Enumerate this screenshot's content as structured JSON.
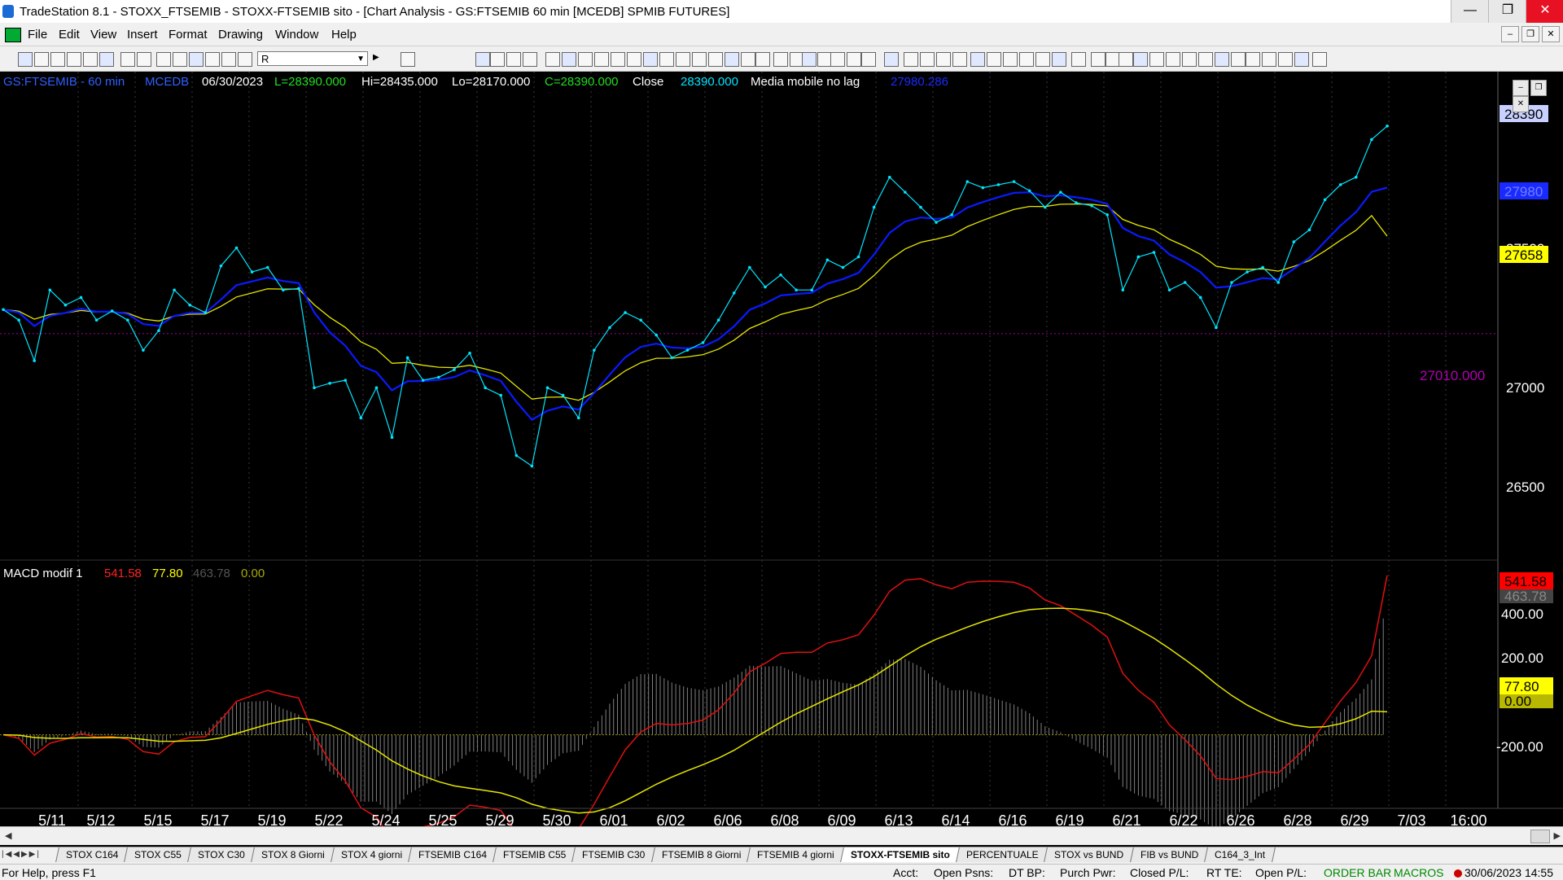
{
  "window": {
    "title": "TradeStation 8.1 - STOXX_FTSEMIB - STOXX-FTSEMIB sito - [Chart Analysis - GS:FTSEMIB  60 min  [MCEDB] SPMIB FUTURES]",
    "minimize": "—",
    "maximize": "❐",
    "close": "✕"
  },
  "menu": [
    "File",
    "Edit",
    "View",
    "Insert",
    "Format",
    "Drawing",
    "Window",
    "Help"
  ],
  "toolbar": {
    "symbol_value": "R"
  },
  "price_header": {
    "symbol": "GS:FTSEMIB - 60 min",
    "exchange": "MCEDB",
    "date": "06/30/2023",
    "last": "L=28390.000",
    "high": "Hi=28435.000",
    "low": "Lo=28170.000",
    "close_eq": "C=28390.000",
    "close_label": "Close",
    "close_value": "28390.000",
    "ma_label": "Media mobile no lag",
    "ma_value": "27980.286"
  },
  "price_axis": {
    "ticks": [
      "27500",
      "27000",
      "26500"
    ],
    "last_tag": "28390",
    "ma_tag": "27980",
    "yellow_tag": "27658",
    "hline_label": "27010.000"
  },
  "macd_header": {
    "name": "MACD modif 1",
    "v1": "541.58",
    "v2": "77.80",
    "v3": "463.78",
    "v4": "0.00"
  },
  "macd_axis": {
    "ticks": [
      "400.00",
      "200.00",
      "-200.00"
    ],
    "tag_red": "541.58",
    "tag_gray": "463.78",
    "tag_yellow": "77.80",
    "tag_zero": "0.00"
  },
  "date_axis": [
    "5/11",
    "5/12",
    "5/15",
    "5/17",
    "5/19",
    "5/22",
    "5/24",
    "5/25",
    "5/29",
    "5/30",
    "6/01",
    "6/02",
    "6/06",
    "6/08",
    "6/09",
    "6/13",
    "6/14",
    "6/16",
    "6/19",
    "6/21",
    "6/22",
    "6/26",
    "6/28",
    "6/29",
    "7/03",
    "16:00"
  ],
  "tabs": [
    "STOX C164",
    "STOX C55",
    "STOX  C30",
    "STOX  8 Giorni",
    "STOX 4 giorni",
    "FTSEMIB C164",
    "FTSEMIB C55",
    "FTSEMIB C30",
    "FTSEMIB  8 Giorni",
    "FTSEMIB  4 giorni",
    "STOXX-FTSEMIB sito",
    "PERCENTUALE",
    "STOX vs BUND",
    "FIB vs BUND",
    "C164_3_Int"
  ],
  "active_tab": "STOXX-FTSEMIB sito",
  "status": {
    "help": "For Help, press F1",
    "acct": "Acct:",
    "open_psns": "Open Psns:",
    "dt_bp": "DT BP:",
    "purch_pwr": "Purch Pwr:",
    "closed_pl": "Closed P/L:",
    "rt_te": "RT TE:",
    "open_pl": "Open P/L:",
    "order_bar": "ORDER BAR",
    "macros": "MACROS",
    "datetime": "30/06/2023 14:55"
  },
  "colors": {
    "price_line": "#00e5ff",
    "blue_ma": "#0a1aff",
    "yellow_ma": "#e6e600",
    "macd_red": "#e01010",
    "macd_yellow": "#e6e600",
    "histogram": "#808080",
    "hline": "#a000a0"
  },
  "chart_data": {
    "type": "line",
    "series": [
      {
        "name": "Close",
        "x": [
          "5/10",
          "5/11",
          "5/11",
          "5/11",
          "5/12",
          "5/12",
          "5/12",
          "5/15",
          "5/15",
          "5/16",
          "5/16",
          "5/17",
          "5/17",
          "5/18",
          "5/18",
          "5/19",
          "5/19",
          "5/19",
          "5/22",
          "5/22",
          "5/23",
          "5/23",
          "5/24",
          "5/24",
          "5/24",
          "5/25",
          "5/25",
          "5/25",
          "5/26",
          "5/26",
          "5/29",
          "5/29",
          "5/29",
          "5/30",
          "5/30",
          "5/30",
          "5/31",
          "5/31",
          "6/01",
          "6/01",
          "6/01",
          "6/02",
          "6/02",
          "6/05",
          "6/05",
          "6/06",
          "6/06",
          "6/07",
          "6/07",
          "6/08",
          "6/08",
          "6/08",
          "6/09",
          "6/09",
          "6/12",
          "6/12",
          "6/13",
          "6/13",
          "6/13",
          "6/14",
          "6/14",
          "6/14",
          "6/15",
          "6/15",
          "6/16",
          "6/16",
          "6/16",
          "6/19",
          "6/19",
          "6/20",
          "6/20",
          "6/21",
          "6/21",
          "6/21",
          "6/22",
          "6/22",
          "6/22",
          "6/23",
          "6/23",
          "6/26",
          "6/26",
          "6/26",
          "6/27",
          "6/27",
          "6/28",
          "6/28",
          "6/29",
          "6/29",
          "6/29",
          "6/30"
        ],
        "y": [
          27170,
          27100,
          26830,
          27300,
          27200,
          27250,
          27100,
          27160,
          27100,
          26900,
          27030,
          27300,
          27200,
          27150,
          27460,
          27580,
          27420,
          27450,
          27300,
          27310,
          26650,
          26680,
          26700,
          26450,
          26650,
          26320,
          26850,
          26700,
          26720,
          26770,
          26880,
          26650,
          26600,
          26200,
          26130,
          26650,
          26600,
          26450,
          26900,
          27050,
          27150,
          27100,
          27000,
          26850,
          26900,
          26950,
          27100,
          27280,
          27450,
          27320,
          27400,
          27300,
          27300,
          27500,
          27450,
          27520,
          27850,
          28050,
          27950,
          27850,
          27750,
          27800,
          28020,
          27980,
          28000,
          28020,
          27960,
          27850,
          27950,
          27880,
          27860,
          27800,
          27300,
          27520,
          27550,
          27300,
          27350,
          27250,
          27050,
          27350,
          27420,
          27450,
          27350,
          27620,
          27700,
          27900,
          28000,
          28050,
          28300,
          28390
        ]
      },
      {
        "name": "Media mobile no lag",
        "value_last": 27980.286
      },
      {
        "name": "Yellow MA",
        "value_last": 27658
      }
    ],
    "indicator": {
      "name": "MACD modif 1",
      "values": [
        541.58,
        77.8,
        463.78,
        0.0
      ]
    },
    "reference_line": 27010,
    "ylim_price": [
      26100,
      28600
    ],
    "ylim_macd": [
      -250,
      560
    ]
  }
}
